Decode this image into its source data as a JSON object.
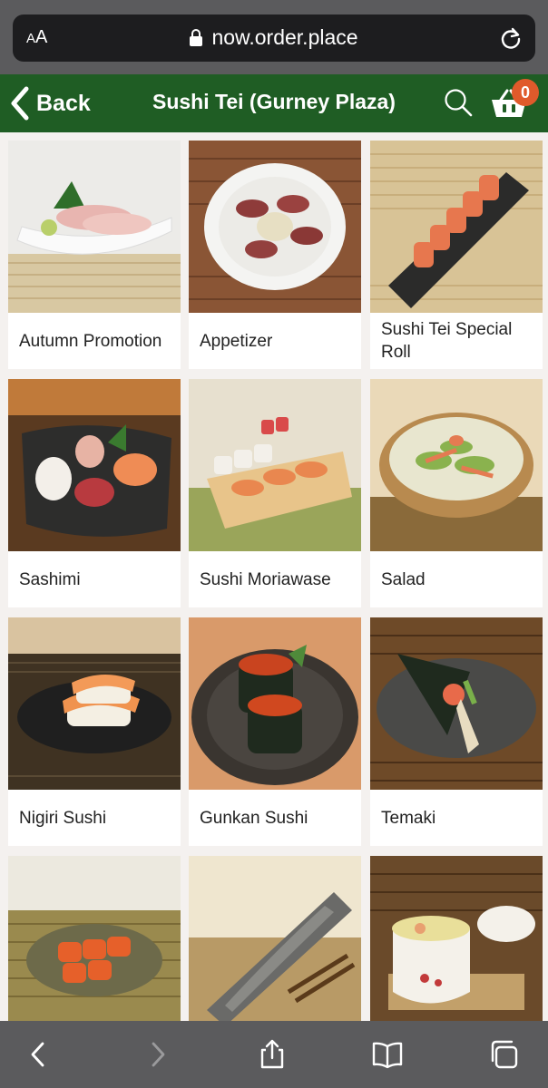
{
  "browser": {
    "text_size_label_small": "A",
    "text_size_label_large": "A",
    "url": "now.order.place",
    "lock_icon": "lock-icon",
    "reload_icon": "reload-icon",
    "toolbar": [
      "back-arrow-icon",
      "forward-arrow-icon",
      "share-icon",
      "bookmarks-icon",
      "tabs-icon"
    ]
  },
  "header": {
    "back_label": "Back",
    "title": "Sushi Tei (Gurney Plaza)",
    "cart_count": "0",
    "accent_color": "#1f5d24",
    "badge_color": "#e05a2b"
  },
  "categories": [
    {
      "label": "Autumn Promotion"
    },
    {
      "label": "Appetizer"
    },
    {
      "label": "Sushi Tei Special Roll"
    },
    {
      "label": "Sashimi"
    },
    {
      "label": "Sushi Moriawase"
    },
    {
      "label": "Salad"
    },
    {
      "label": "Nigiri Sushi"
    },
    {
      "label": "Gunkan Sushi"
    },
    {
      "label": "Temaki"
    },
    {
      "label": ""
    },
    {
      "label": ""
    },
    {
      "label": ""
    }
  ]
}
